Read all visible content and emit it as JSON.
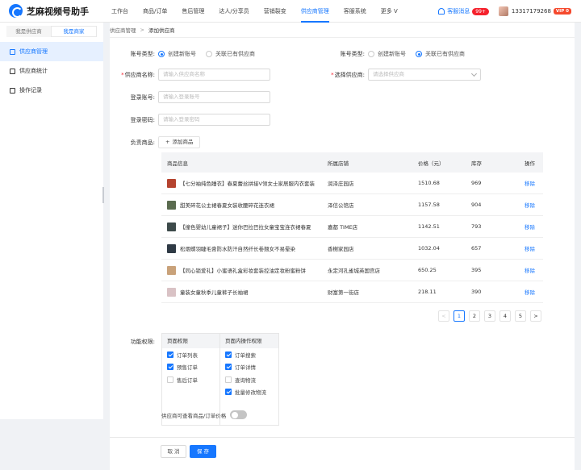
{
  "app": {
    "name": "芝麻视频号助手"
  },
  "nav": {
    "items": [
      "工作台",
      "商品/订单",
      "售后管理",
      "达人/分享员",
      "营销裂变",
      "供应商管理",
      "客服系统",
      "更多 V"
    ],
    "active_index": 5
  },
  "header": {
    "message_label": "客服消息",
    "message_badge": "99+",
    "phone": "13317179268",
    "vip": "VIP 0"
  },
  "sidebar": {
    "tabs": [
      "我是供应商",
      "我是商家"
    ],
    "active_tab": 1,
    "items": [
      {
        "label": "供应商管理",
        "icon": "supplier-icon"
      },
      {
        "label": "供应商统计",
        "icon": "stats-icon"
      },
      {
        "label": "操作记录",
        "icon": "record-icon"
      }
    ]
  },
  "breadcrumb": {
    "parent": "供应商管理",
    "separator": ">",
    "current": "添加供应商"
  },
  "form": {
    "account_type": {
      "label": "账号类型:",
      "options": [
        "创建新账号",
        "关联已有供应商"
      ],
      "selected": "创建新账号"
    },
    "account_type_right": {
      "label": "账号类型:",
      "options": [
        "创建新账号",
        "关联已有供应商"
      ],
      "selected": "关联已有供应商"
    },
    "supplier_name": {
      "label": "供应商名称:",
      "placeholder": "请输入供应商名称"
    },
    "select_supplier": {
      "label": "选择供应商:",
      "placeholder": "请选择供应商"
    },
    "login_account": {
      "label": "登录账号:",
      "placeholder": "请输入登录账号"
    },
    "login_password": {
      "label": "登录密码:",
      "placeholder": "请输入登录密码"
    },
    "products": {
      "label": "负责商品:",
      "add_button": "添加商品"
    }
  },
  "table": {
    "headers": [
      "商品信息",
      "所属店铺",
      "价格（元）",
      "库存",
      "操作"
    ],
    "rows": [
      {
        "name": "【七分袖纯色睡衣】春夏蕾丝拼接V领女士家居服内衣套装",
        "shop": "润泽庄园店",
        "price": "1510.68",
        "stock": "969",
        "action": "移除",
        "thumb_color": "#b5432f"
      },
      {
        "name": "甜美碎花公主裙春夏女装收腰碎花连衣裙",
        "shop": "泽信公馆店",
        "price": "1157.58",
        "stock": "904",
        "action": "移除",
        "thumb_color": "#5a6b4f"
      },
      {
        "name": "【撞色婴幼儿童裙子】迷你巴拉巴拉女童宝宝连衣裙春夏",
        "shop": "嘉都 TIME店",
        "price": "1142.51",
        "stock": "793",
        "action": "移除",
        "thumb_color": "#3d4a4a"
      },
      {
        "name": "松烟蝶羽睫毛膏防水防汗自然纤长卷翘女不易晕染",
        "shop": "香榭家园店",
        "price": "1032.04",
        "stock": "657",
        "action": "移除",
        "thumb_color": "#2f3a45"
      },
      {
        "name": "【同心锁爱礼】小蜜语礼盒彩妆套装控油定妆粉蜜粉饼",
        "shop": "永定河孔雀城英国宫店",
        "price": "650.25",
        "stock": "395",
        "action": "移除",
        "thumb_color": "#c9a27a"
      },
      {
        "name": "童装女童秋季儿童裤子长袖裙",
        "shop": "财富第一街店",
        "price": "218.11",
        "stock": "390",
        "action": "移除",
        "thumb_color": "#d9c2c5"
      }
    ]
  },
  "pagination": {
    "prev": "<",
    "pages": [
      "1",
      "2",
      "3",
      "4",
      "5"
    ],
    "current": "1",
    "next": ">"
  },
  "permissions": {
    "label": "功能权限:",
    "page_col": {
      "title": "页面权限",
      "items": [
        {
          "label": "订单列表",
          "checked": true
        },
        {
          "label": "预售订单",
          "checked": true
        },
        {
          "label": "售后订单",
          "checked": false
        }
      ]
    },
    "op_col": {
      "title": "页面内操作权限",
      "items": [
        {
          "label": "订单搜索",
          "checked": true
        },
        {
          "label": "订单详情",
          "checked": true
        },
        {
          "label": "查询物流",
          "checked": false
        },
        {
          "label": "批量修改物流",
          "checked": true
        }
      ]
    }
  },
  "price_visibility": {
    "label": "供应商可查看商品/订单价格",
    "enabled": false
  },
  "footer": {
    "cancel": "取 消",
    "save": "保 存"
  },
  "colors": {
    "primary": "#1677ff",
    "danger": "#f5222d",
    "vip": "#f5492d"
  }
}
